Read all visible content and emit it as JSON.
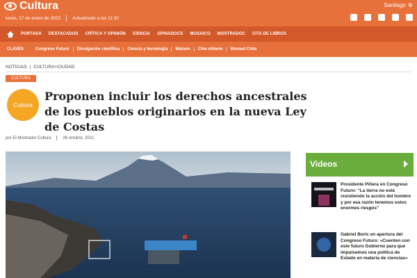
{
  "site": {
    "logo_text": "Cultura",
    "date": "lunes, 17 de enero de 2022",
    "updated": "Actualizado a las 11:30",
    "city": "Santiago",
    "city_icon": "gear-icon",
    "social_icons": [
      "facebook-icon",
      "twitter-icon",
      "instagram-icon",
      "mail-icon",
      "print-icon"
    ]
  },
  "mainnav": {
    "items": [
      "PORTADA",
      "DESTACADOS",
      "CRÍTICA Y OPINIÓN",
      "CIENCIA",
      "OPINADOCS",
      "MOSAICO",
      "MOSTRADOC",
      "CITA DE LIBROS"
    ]
  },
  "subnav": {
    "items": [
      "CLAVES",
      "Congreso Futuro",
      "Divulgación científica",
      "Ciencia y tecnología",
      "Watson",
      "Cine chileno",
      "Womad Chile"
    ]
  },
  "breadcrumb": {
    "section": "NOTICIAS",
    "sep": "|",
    "subsection": "CULTURA+CIUDAD"
  },
  "article": {
    "tag": "CULTURA",
    "badge": "Cultura",
    "title": "Proponen incluir los derechos ancestrales de los pueblos originarios en la nueva Ley de Costas",
    "author_prefix": "por",
    "author": "El Mostrador Cultura",
    "date": "26 octubre, 2021"
  },
  "videos": {
    "title": "Videos",
    "items": [
      {
        "text": "Presidente Piñera en Congreso Futuro: “La tierra no está resistiendo la acción del hombre y por esa razón tenemos estos enormes riesgos”"
      },
      {
        "text": "Gabriel Boric en apertura del Congreso Futuro: «Cuenten con este futuro Gobierno para que impulsemos una política de Estado en materia de ciencias»"
      }
    ]
  },
  "colors": {
    "brand_orange": "#e8703a",
    "nav_dark": "#d3582a",
    "videos_green": "#6aad3d",
    "badge_yellow": "#f5a623"
  }
}
